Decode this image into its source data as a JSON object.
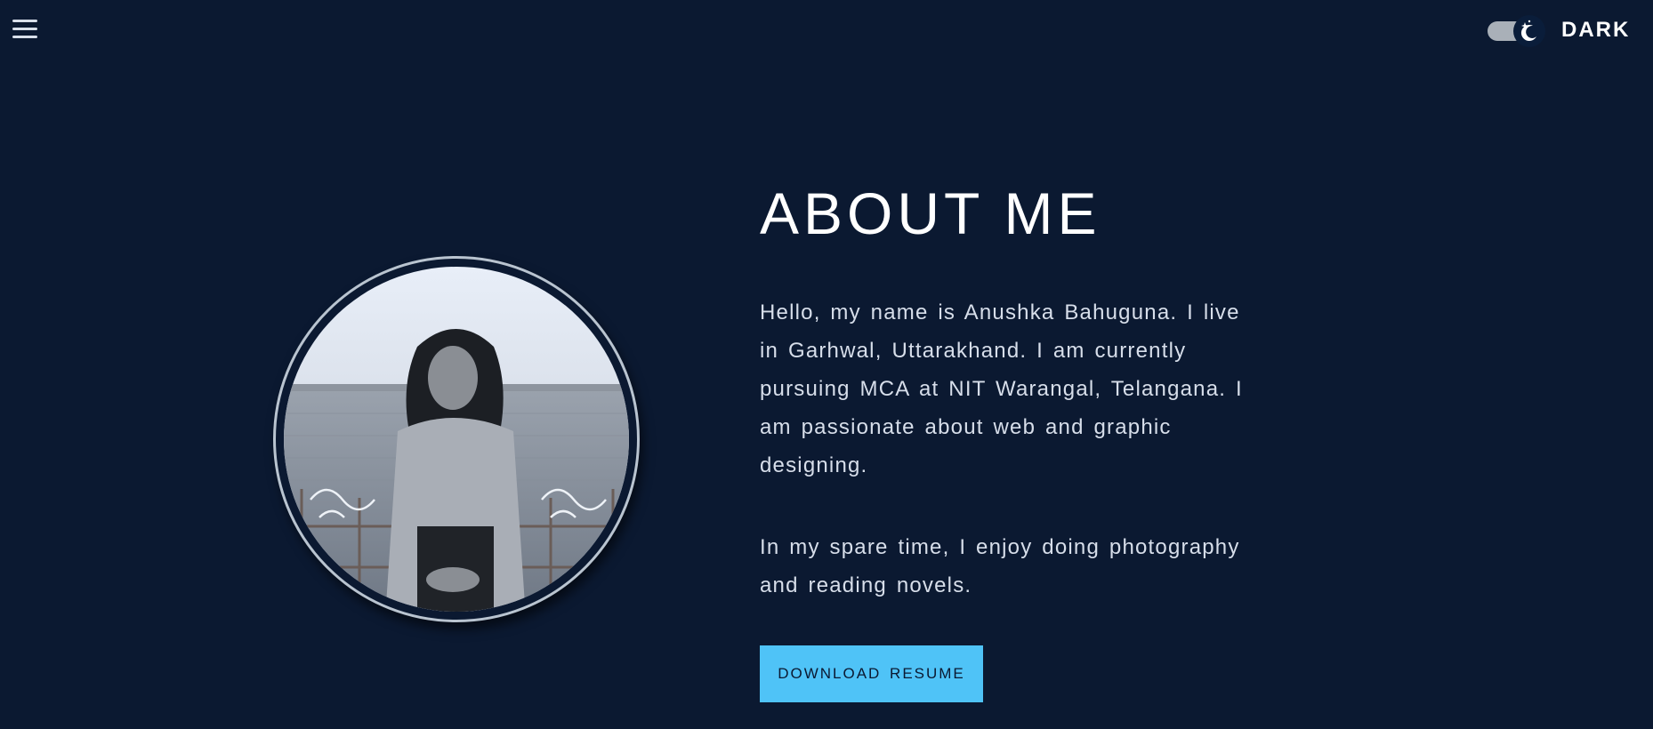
{
  "nav": {
    "menu_icon": "hamburger-menu-icon"
  },
  "theme_toggle": {
    "icon": "moon-stars-icon",
    "label": "DARK",
    "state": "dark"
  },
  "about": {
    "heading": "ABOUT ME",
    "paragraph_1": "Hello, my name is Anushka Bahuguna. I live in Garhwal, Uttarakhand. I am currently pursuing MCA at NIT Warangal, Telangana. I am passionate about web and graphic designing.",
    "paragraph_2": "In my spare time, I enjoy doing photography and reading novels.",
    "button_label": "DOWNLOAD RESUME"
  },
  "colors": {
    "background": "#0b1931",
    "accent": "#4fc3f7",
    "text": "#d7deea",
    "heading": "#ffffff"
  }
}
